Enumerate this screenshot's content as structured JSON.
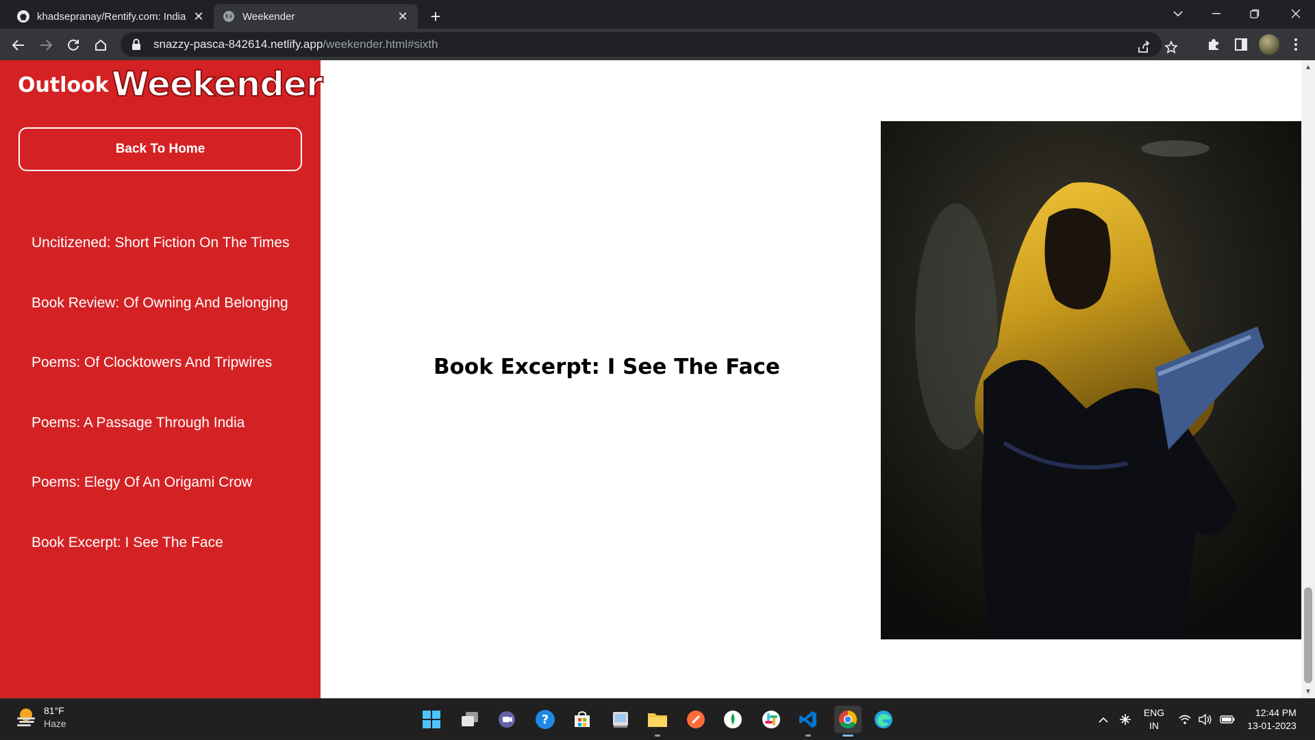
{
  "browser": {
    "tabs": [
      {
        "title": "khadsepranay/Rentify.com: India",
        "active": false,
        "icon": "github-icon"
      },
      {
        "title": "Weekender",
        "active": true,
        "icon": "globe-icon"
      }
    ],
    "url_domain": "snazzy-pasca-842614.netlify.app",
    "url_path": "/weekender.html#sixth"
  },
  "sidebar": {
    "logo_outlook": "Outlook",
    "logo_weekender": "Weekender",
    "home_button": "Back To Home",
    "items": [
      {
        "label": "Uncitizened: Short Fiction On The Times"
      },
      {
        "label": "Book Review: Of Owning And Belonging"
      },
      {
        "label": "Poems: Of Clocktowers And Tripwires"
      },
      {
        "label": "Poems: A Passage Through India"
      },
      {
        "label": "Poems: Elegy Of An Origami Crow"
      },
      {
        "label": "Book Excerpt: I See The Face"
      }
    ]
  },
  "main": {
    "title": "Book Excerpt: I See The Face"
  },
  "taskbar": {
    "weather_temp": "81°F",
    "weather_desc": "Haze",
    "lang_line1": "ENG",
    "lang_line2": "IN",
    "time": "12:44 PM",
    "date": "13-01-2023"
  },
  "colors": {
    "sidebar_bg": "#d42224",
    "page_bg": "#ffffff",
    "chrome_bg": "#202124",
    "toolbar_bg": "#35363a"
  }
}
